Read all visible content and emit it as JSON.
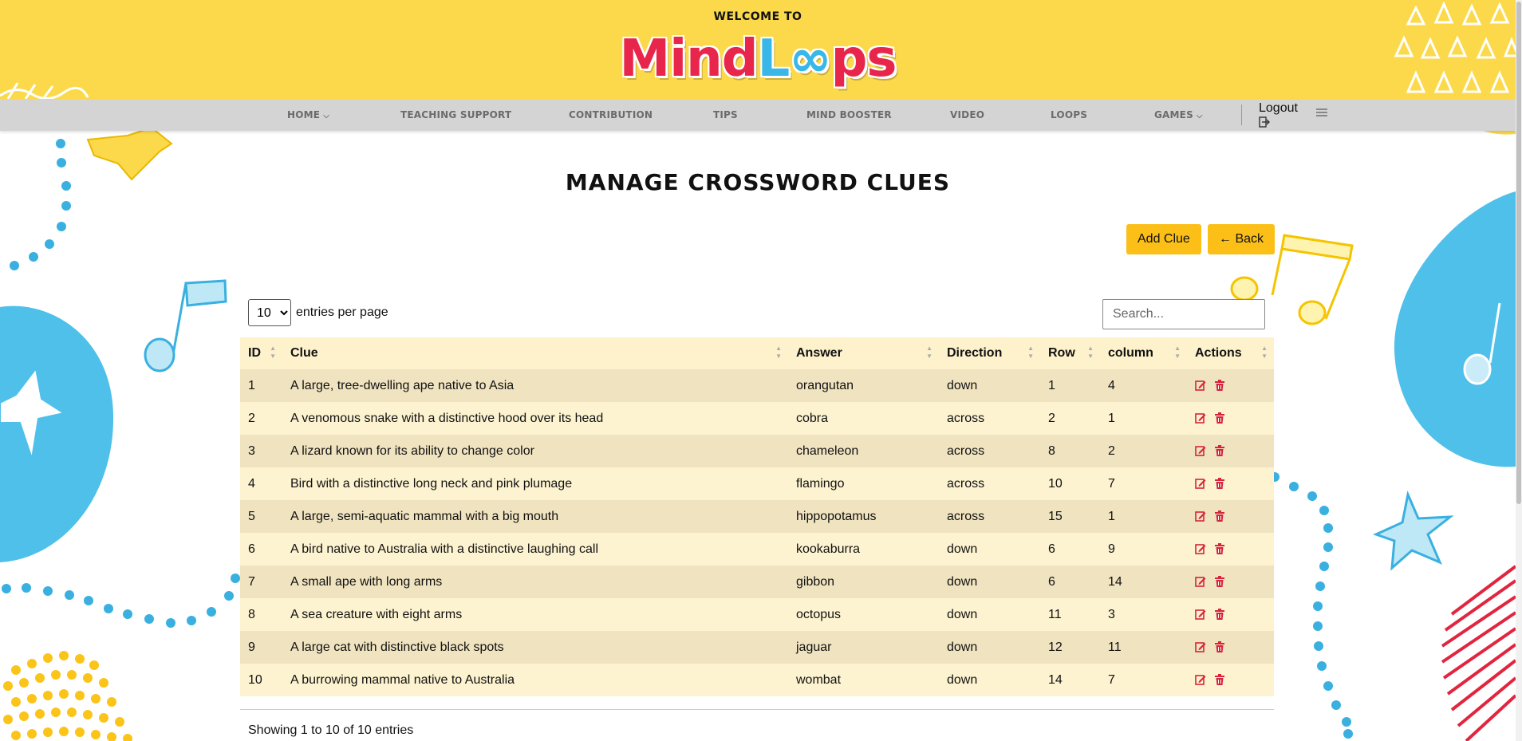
{
  "header": {
    "welcome": "WELCOME TO",
    "logo": "MindLoops"
  },
  "nav": {
    "items": [
      {
        "label": "HOME",
        "has_dropdown": true
      },
      {
        "label": "TEACHING SUPPORT",
        "has_dropdown": false
      },
      {
        "label": "CONTRIBUTION",
        "has_dropdown": false
      },
      {
        "label": "TIPS",
        "has_dropdown": false
      },
      {
        "label": "MIND BOOSTER",
        "has_dropdown": false
      },
      {
        "label": "VIDEO",
        "has_dropdown": false
      },
      {
        "label": "LOOPS",
        "has_dropdown": false
      },
      {
        "label": "GAMES",
        "has_dropdown": true
      }
    ],
    "logout": "Logout",
    "dropdown_chevron": "⌵"
  },
  "page": {
    "title": "MANAGE CROSSWORD CLUES",
    "add_button": "Add Clue",
    "back_button": "← Back"
  },
  "table_controls": {
    "entries_value": "10",
    "entries_label": "entries per page",
    "search_placeholder": "Search..."
  },
  "table": {
    "columns": [
      "ID",
      "Clue",
      "Answer",
      "Direction",
      "Row",
      "column",
      "Actions"
    ],
    "rows": [
      {
        "id": "1",
        "clue": "A large, tree-dwelling ape native to Asia",
        "answer": "orangutan",
        "direction": "down",
        "row": "1",
        "column": "4"
      },
      {
        "id": "2",
        "clue": "A venomous snake with a distinctive hood over its head",
        "answer": "cobra",
        "direction": "across",
        "row": "2",
        "column": "1"
      },
      {
        "id": "3",
        "clue": "A lizard known for its ability to change color",
        "answer": "chameleon",
        "direction": "across",
        "row": "8",
        "column": "2"
      },
      {
        "id": "4",
        "clue": "Bird with a distinctive long neck and pink plumage",
        "answer": "flamingo",
        "direction": "across",
        "row": "10",
        "column": "7"
      },
      {
        "id": "5",
        "clue": "A large, semi-aquatic mammal with a big mouth",
        "answer": "hippopotamus",
        "direction": "across",
        "row": "15",
        "column": "1"
      },
      {
        "id": "6",
        "clue": "A bird native to Australia with a distinctive laughing call",
        "answer": "kookaburra",
        "direction": "down",
        "row": "6",
        "column": "9"
      },
      {
        "id": "7",
        "clue": "A small ape with long arms",
        "answer": "gibbon",
        "direction": "down",
        "row": "6",
        "column": "14"
      },
      {
        "id": "8",
        "clue": "A sea creature with eight arms",
        "answer": "octopus",
        "direction": "down",
        "row": "11",
        "column": "3"
      },
      {
        "id": "9",
        "clue": "A large cat with distinctive black spots",
        "answer": "jaguar",
        "direction": "down",
        "row": "12",
        "column": "11"
      },
      {
        "id": "10",
        "clue": "A burrowing mammal native to Australia",
        "answer": "wombat",
        "direction": "down",
        "row": "14",
        "column": "7"
      }
    ],
    "row_actions": [
      "edit-icon",
      "delete-icon"
    ],
    "info": "Showing 1 to 10 of 10 entries"
  },
  "colors": {
    "header_bg": "#fcd94a",
    "nav_bg": "#d4d4d4",
    "button_bg": "#fbbf17",
    "logo_red": "#e8264c",
    "logo_blue": "#39b7e8",
    "row_odd": "#f0e3c0",
    "row_even": "#fdf3d0",
    "action_red": "#d6243c"
  }
}
